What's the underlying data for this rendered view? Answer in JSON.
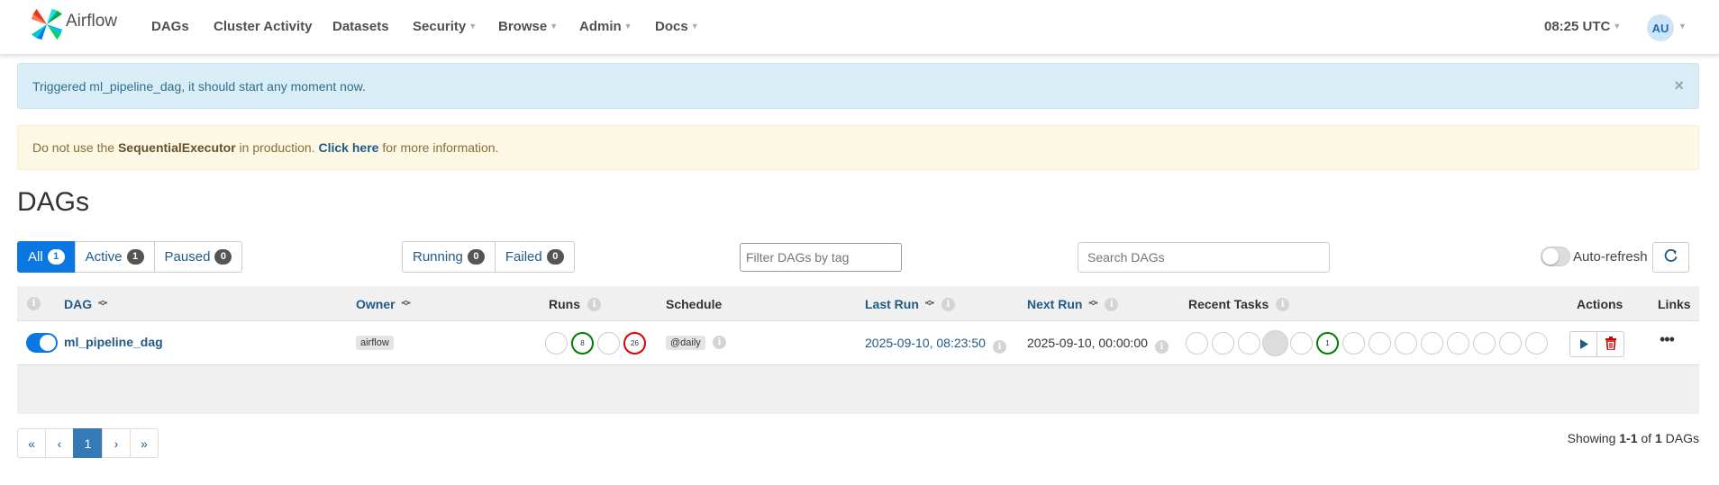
{
  "brand": {
    "name": "Airflow",
    "icon": "airflow-pinwheel-logo"
  },
  "nav": {
    "items": [
      {
        "label": "DAGs",
        "dropdown": false
      },
      {
        "label": "Cluster Activity",
        "dropdown": false
      },
      {
        "label": "Datasets",
        "dropdown": false
      },
      {
        "label": "Security",
        "dropdown": true
      },
      {
        "label": "Browse",
        "dropdown": true
      },
      {
        "label": "Admin",
        "dropdown": true
      },
      {
        "label": "Docs",
        "dropdown": true
      }
    ],
    "time": "08:25 UTC",
    "avatar": "AU"
  },
  "alerts": {
    "info": "Triggered ml_pipeline_dag, it should start any moment now.",
    "info_close": "×",
    "warn_prefix": "Do not use the ",
    "warn_bold": "SequentialExecutor",
    "warn_mid": " in production. ",
    "warn_link": "Click here",
    "warn_suffix": " for more information."
  },
  "page_title": "DAGs",
  "filters": {
    "status": [
      {
        "label": "All",
        "count": "1",
        "active": true
      },
      {
        "label": "Active",
        "count": "1",
        "active": false
      },
      {
        "label": "Paused",
        "count": "0",
        "active": false
      }
    ],
    "runstate": [
      {
        "label": "Running",
        "count": "0"
      },
      {
        "label": "Failed",
        "count": "0"
      }
    ],
    "tag_filter_placeholder": "Filter DAGs by tag",
    "search_placeholder": "Search DAGs",
    "auto_refresh_label": "Auto-refresh"
  },
  "table": {
    "headers": {
      "dag": "DAG",
      "owner": "Owner",
      "runs": "Runs",
      "schedule": "Schedule",
      "last_run": "Last Run",
      "next_run": "Next Run",
      "recent_tasks": "Recent Tasks",
      "actions": "Actions",
      "links": "Links"
    },
    "rows": [
      {
        "dag_id": "ml_pipeline_dag",
        "paused": false,
        "owner": "airflow",
        "runs": [
          {
            "state": "queued",
            "count": ""
          },
          {
            "state": "success",
            "count": "8"
          },
          {
            "state": "running",
            "count": ""
          },
          {
            "state": "failed",
            "count": "26"
          }
        ],
        "schedule": "@daily",
        "last_run": "2025-09-10, 08:23:50",
        "next_run": "2025-09-10, 00:00:00",
        "recent_tasks": [
          {
            "state": "none",
            "count": ""
          },
          {
            "state": "none",
            "count": ""
          },
          {
            "state": "none",
            "count": ""
          },
          {
            "state": "queued",
            "count": ""
          },
          {
            "state": "none",
            "count": ""
          },
          {
            "state": "success",
            "count": "1"
          },
          {
            "state": "none",
            "count": ""
          },
          {
            "state": "none",
            "count": ""
          },
          {
            "state": "none",
            "count": ""
          },
          {
            "state": "none",
            "count": ""
          },
          {
            "state": "none",
            "count": ""
          },
          {
            "state": "none",
            "count": ""
          },
          {
            "state": "none",
            "count": ""
          },
          {
            "state": "none",
            "count": ""
          }
        ]
      }
    ]
  },
  "pagination": {
    "first": "«",
    "prev": "‹",
    "current": "1",
    "next": "›",
    "last": "»"
  },
  "showing": {
    "prefix": "Showing ",
    "range": "1-1",
    "mid": " of ",
    "total": "1",
    "suffix": " DAGs"
  },
  "colors": {
    "primary": "#0b77e3",
    "link": "#1f5b87",
    "success": "#008000",
    "failed": "#e00000",
    "info_bg": "#d9edf7",
    "warn_bg": "#fcf8e3"
  }
}
